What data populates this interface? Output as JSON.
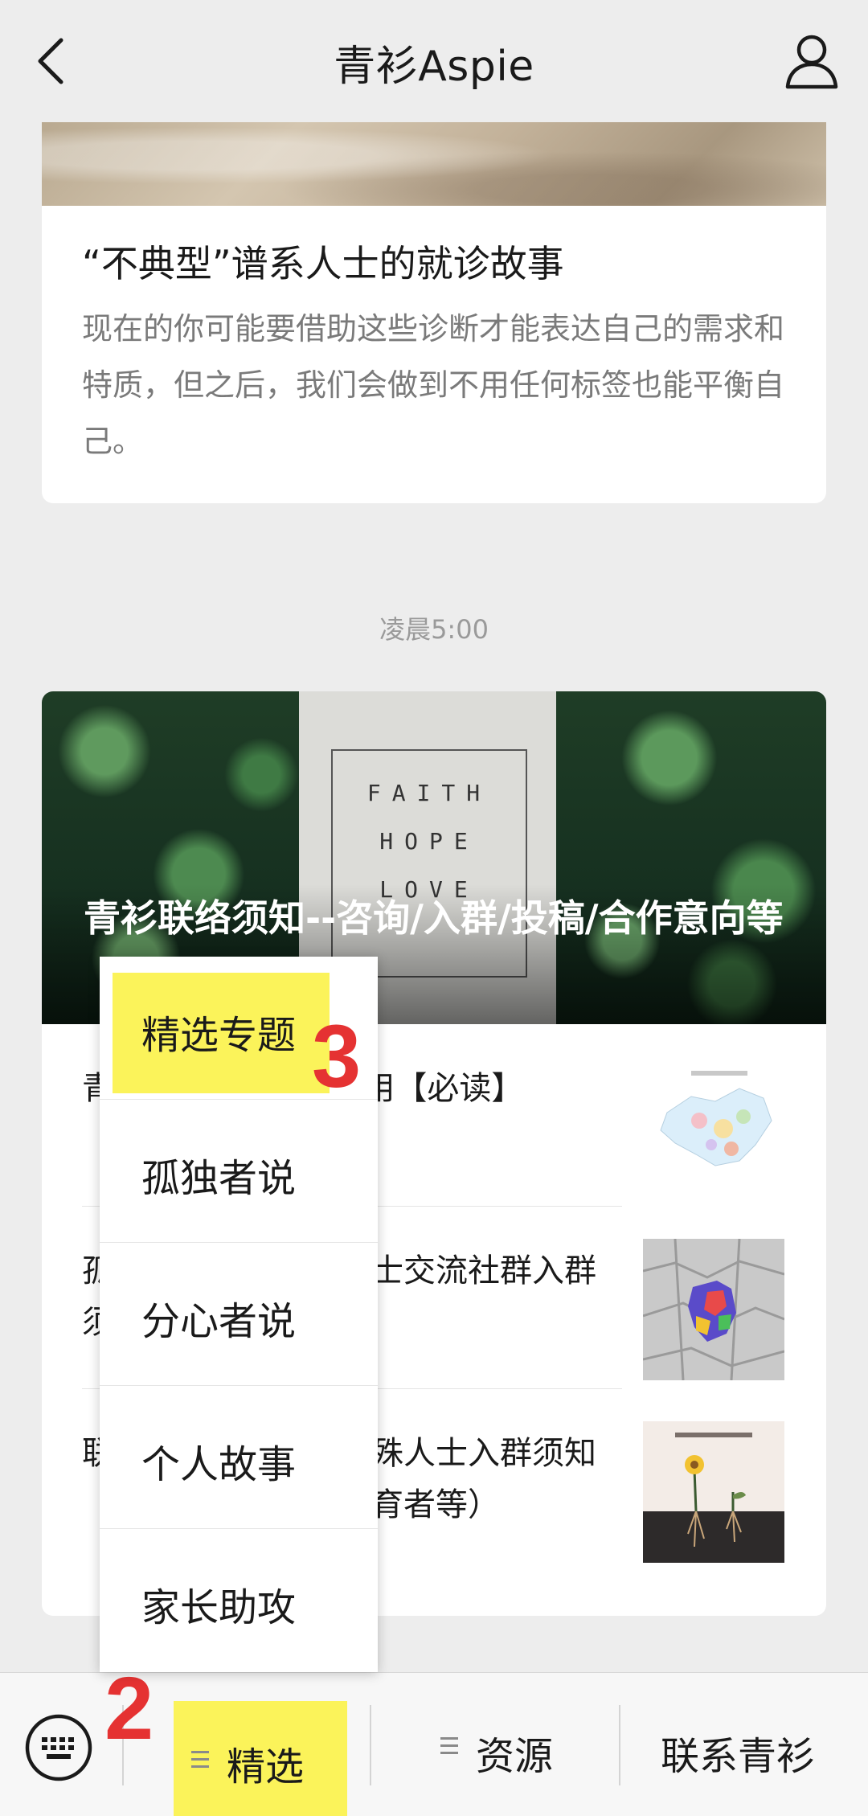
{
  "header": {
    "title": "青衫Aspie",
    "back_icon": "chevron-left-icon",
    "profile_icon": "person-icon"
  },
  "article1": {
    "title": "“不典型”谱系人士的就诊故事",
    "desc": "现在的你可能要借助这些诊断才能表达自己的需求和特质，但之后，我们会做到不用任何标签也能平衡自己。"
  },
  "timestamp": "凌晨5:00",
  "article2": {
    "hero_title": "青衫联络须知--咨询/入群/投稿/合作意向等",
    "hero_image_words": [
      "FAITH",
      "HOPE",
      "LOVE"
    ],
    "sub_articles": [
      {
        "title": "青衫Aspie公众号使用【必读】",
        "thumb": "china-map-thumbnail"
      },
      {
        "title": "孤独症／阿斯伯格人士交流社群入群须知（必须阅读）",
        "thumb": "puzzle-pieces-thumbnail"
      },
      {
        "title": "联系青衫／合作及特殊人士入群须知（家庭成员、特殊教育者等）",
        "thumb": "flowers-drawing-thumbnail"
      }
    ]
  },
  "popup_menu": {
    "items": [
      "精选专题",
      "孤独者说",
      "分心者说",
      "个人故事",
      "家长助攻"
    ]
  },
  "annotations": {
    "step2": "2",
    "step3": "3",
    "highlight_color": "#fbf35a",
    "annotation_color": "#e53232"
  },
  "bottom_bar": {
    "keyboard_icon": "keyboard-icon",
    "menu_icon": "hamburger-menu-icon",
    "tab1": "精选",
    "tab2": "资源",
    "tab3": "联系青衫"
  }
}
